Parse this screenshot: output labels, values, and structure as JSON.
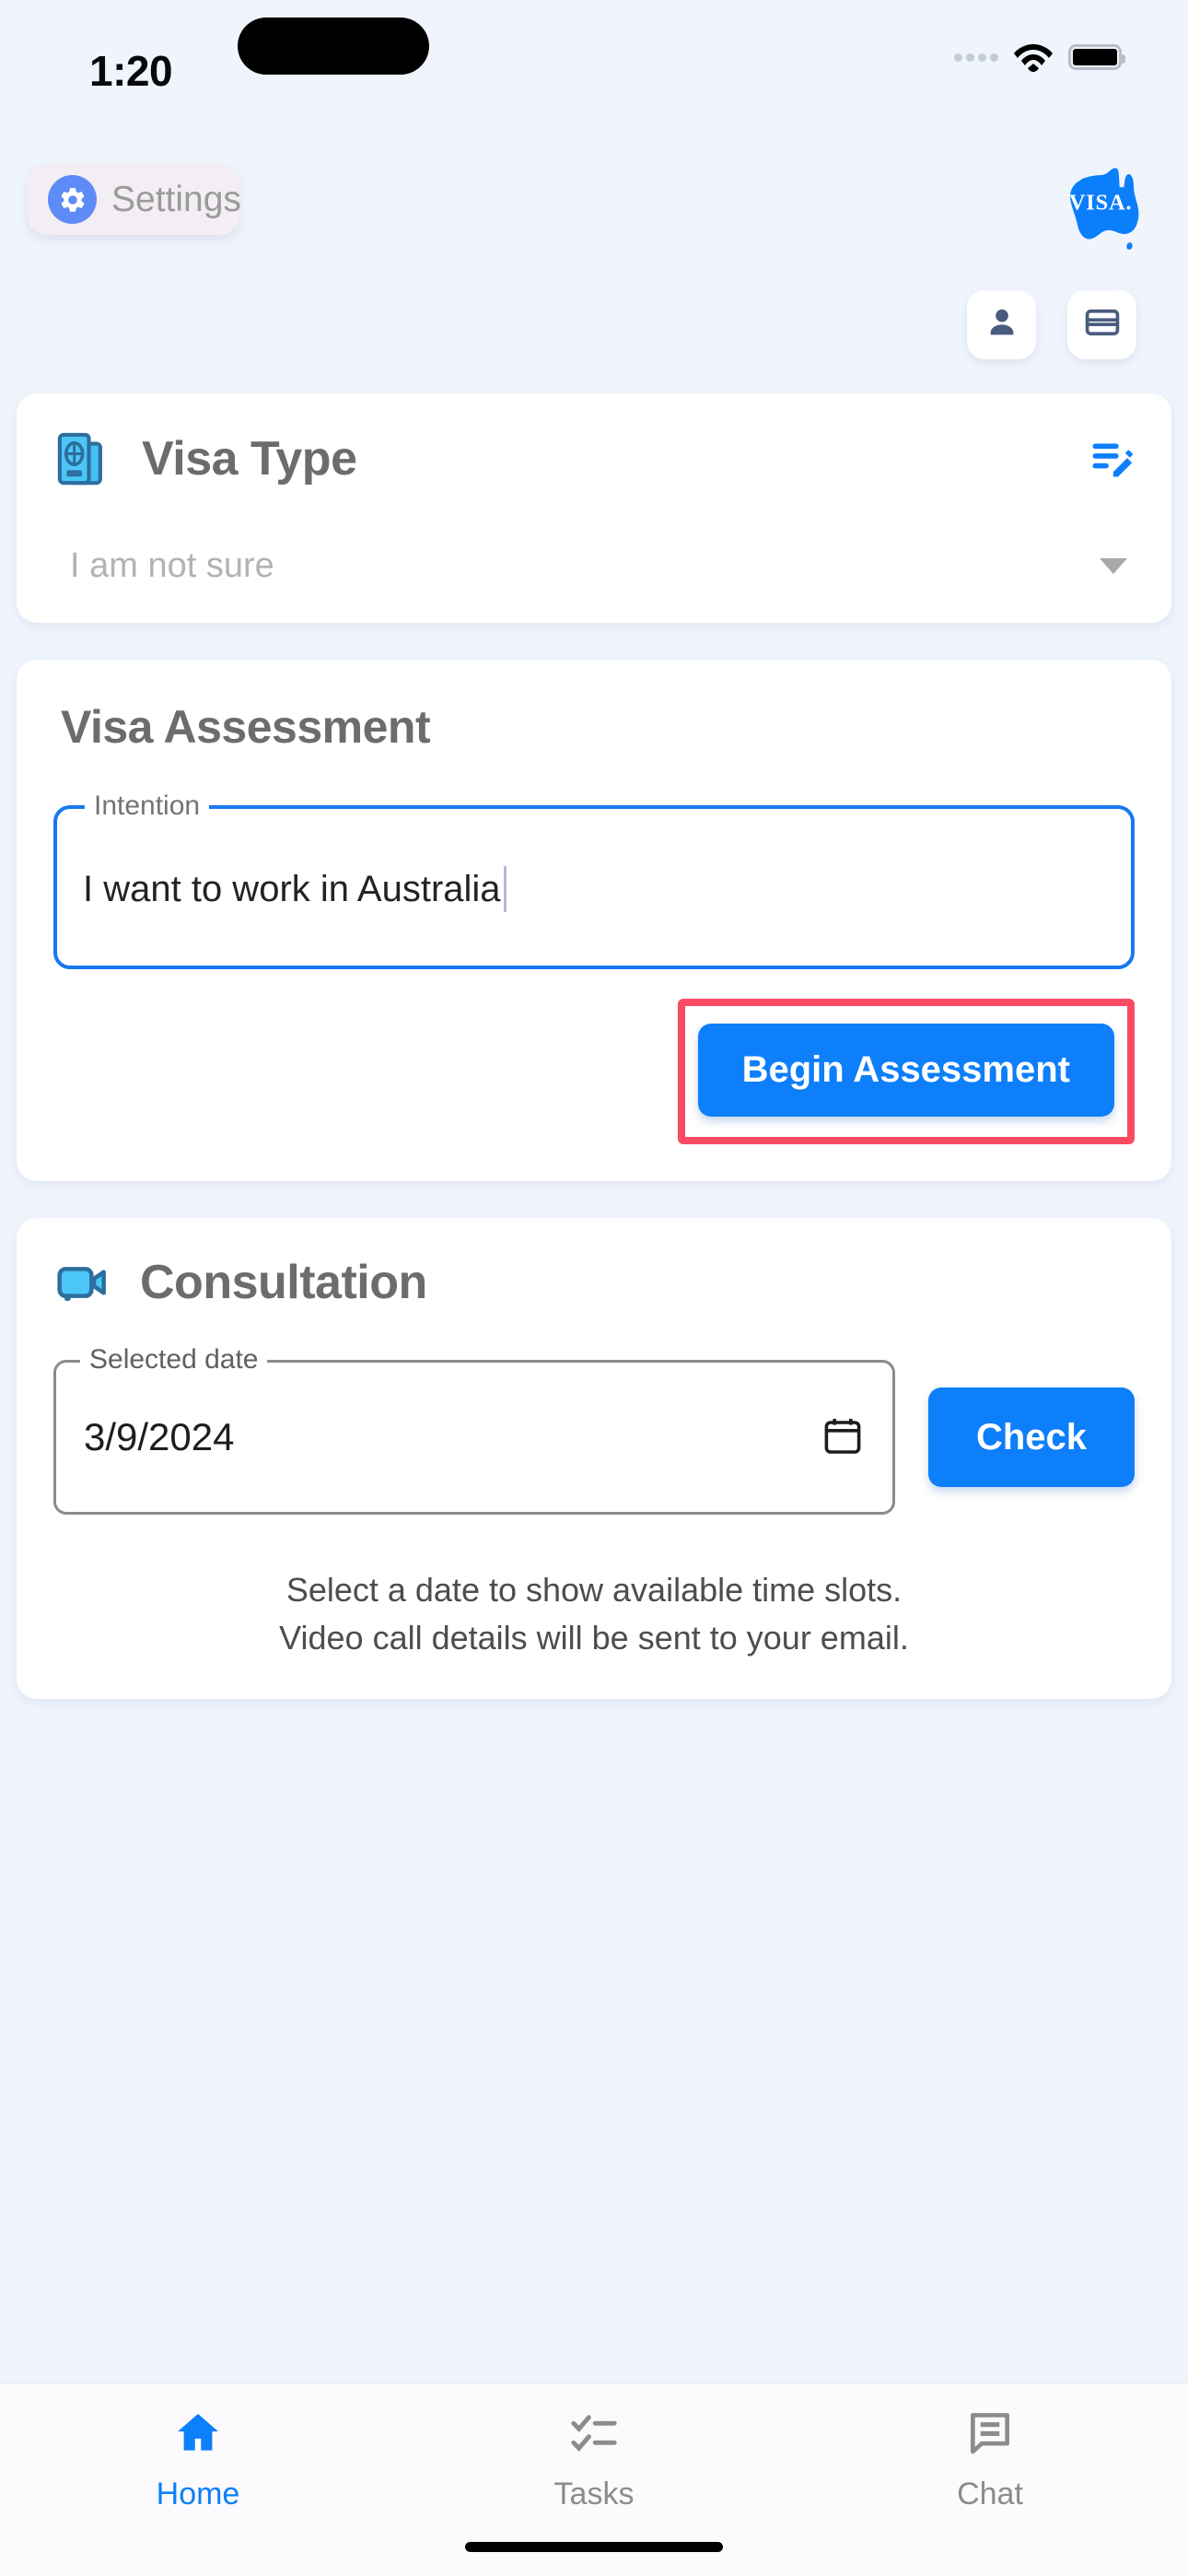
{
  "status_bar": {
    "time": "1:20",
    "signal_icon": "signal-dots-icon",
    "wifi_icon": "wifi-icon",
    "battery_icon": "battery-icon"
  },
  "top_bar": {
    "settings_label": "Settings",
    "settings_icon": "gear-icon",
    "logo_text": "VISA.",
    "logo_icon": "australia-map-logo"
  },
  "quick_actions": [
    {
      "name": "account-button",
      "icon": "person-icon"
    },
    {
      "name": "payment-button",
      "icon": "credit-card-icon"
    }
  ],
  "visa_type_card": {
    "title": "Visa Type",
    "icon": "passport-icon",
    "edit_icon": "edit-note-icon",
    "selected_value": "I am not sure",
    "dropdown_icon": "caret-down-icon"
  },
  "assessment_card": {
    "title": "Visa Assessment",
    "intention_label": "Intention",
    "intention_value": "I want to work in Australia",
    "begin_button_label": "Begin Assessment",
    "highlight_color": "#fa4b62"
  },
  "consultation_card": {
    "title": "Consultation",
    "icon": "video-camera-icon",
    "date_label": "Selected date",
    "date_value": "3/9/2024",
    "calendar_icon": "calendar-icon",
    "check_button_label": "Check",
    "hint_line_1": "Select a date to show available time slots.",
    "hint_line_2": "Video call details will be sent to your email."
  },
  "bottom_nav": {
    "items": [
      {
        "label": "Home",
        "icon": "home-icon",
        "active": true
      },
      {
        "label": "Tasks",
        "icon": "checklist-icon",
        "active": false
      },
      {
        "label": "Chat",
        "icon": "chat-bubble-icon",
        "active": false
      }
    ]
  },
  "colors": {
    "accent_blue": "#0d7ffa",
    "background": "#f0f5fd",
    "title_gray": "#6c6c6c",
    "highlight_red": "#fa4b62"
  }
}
